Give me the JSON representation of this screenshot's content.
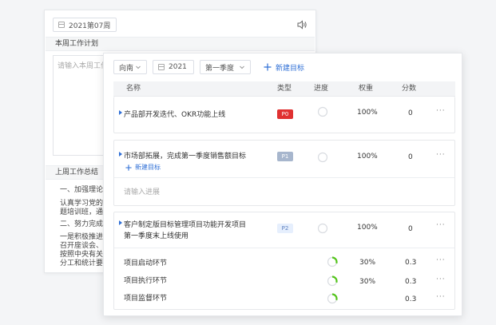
{
  "colors": {
    "accent": "#2f6fd6",
    "p0": "#e03131",
    "p1": "#a7b6cd",
    "p2_bg": "#e6effd",
    "p2_text": "#5b7fbf",
    "progress": "#52c41a"
  },
  "back_panel": {
    "week_value": "2021第07周",
    "plan_header": "本周工作计划",
    "plan_placeholder": "请输入本周工作",
    "summary_header": "上周工作总结",
    "summary_lines": [
      "一、加强理论学",
      "认真学习党的十",
      "题培训班，通过",
      "二、努力完成我",
      "一是积极推进",
      "召开座谈会、走",
      "按照中央有关要",
      "分工和统计要求"
    ]
  },
  "toolbar": {
    "owner": "向南",
    "year": "2021",
    "quarter": "第一季度",
    "new_goal": "新建目标"
  },
  "table": {
    "headers": {
      "name": "名称",
      "type": "类型",
      "progress": "进度",
      "weight": "权重",
      "score": "分数"
    },
    "goals": [
      {
        "name": "产品部开发迭代、OKR功能上线",
        "type": "P0",
        "progress": 0,
        "weight": "100%",
        "score": "0",
        "menu": "···"
      },
      {
        "name": "市场部拓展，完成第一季度销售额目标",
        "type": "P1",
        "progress": 0,
        "weight": "100%",
        "score": "0",
        "menu": "···",
        "add_child": "新建目标",
        "progress_placeholder": "请输入进展"
      },
      {
        "name_line1": "客户制定版目标管理项目功能开发项目",
        "name_line2": "第一季度末上线使用",
        "type": "P2",
        "progress": 0,
        "weight": "100%",
        "score": "0",
        "menu": "···",
        "subitems": [
          {
            "name": "项目启动环节",
            "progress": 30,
            "weight": "30%",
            "score": "0.3",
            "menu": "···"
          },
          {
            "name": "项目执行环节",
            "progress": 30,
            "weight": "30%",
            "score": "0.3",
            "menu": "···"
          },
          {
            "name": "项目监督环节",
            "progress": 30,
            "weight": "",
            "score": "0.3",
            "menu": "···"
          }
        ]
      }
    ]
  }
}
